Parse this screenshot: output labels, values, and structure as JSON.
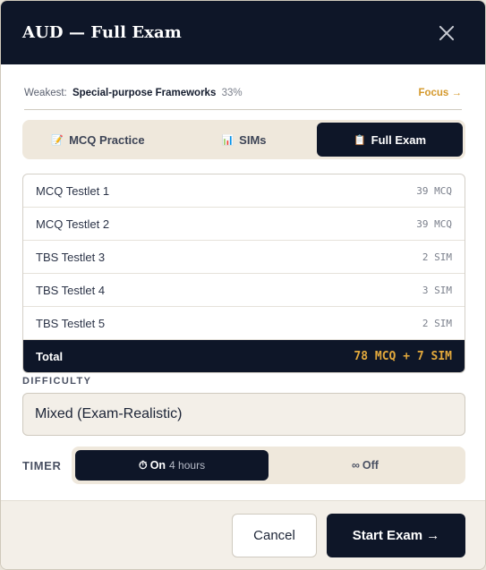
{
  "modal": {
    "title": "AUD — Full Exam",
    "close_icon": "close-icon"
  },
  "weakness": {
    "label": "Weakest:",
    "topic": "Special-purpose Frameworks",
    "percent": "33%",
    "focus_link": "Focus →"
  },
  "mode_tabs": [
    {
      "icon": "📝",
      "label": "MCQ Practice",
      "active": false
    },
    {
      "icon": "📊",
      "label": "SIMs",
      "active": false
    },
    {
      "icon": "📋",
      "label": "Full Exam",
      "active": true
    }
  ],
  "testlets": [
    {
      "name": "MCQ Testlet 1",
      "count": "39 MCQ"
    },
    {
      "name": "MCQ Testlet 2",
      "count": "39 MCQ"
    },
    {
      "name": "TBS Testlet 3",
      "count": "2 SIM"
    },
    {
      "name": "TBS Testlet 4",
      "count": "3 SIM"
    },
    {
      "name": "TBS Testlet 5",
      "count": "2 SIM"
    }
  ],
  "total": {
    "label": "Total",
    "value": "78 MCQ + 7 SIM"
  },
  "difficulty": {
    "label": "DIFFICULTY",
    "value": "Mixed (Exam-Realistic)"
  },
  "timer": {
    "label": "TIMER",
    "on_icon": "⏱",
    "on_label": "On",
    "on_sub": "4 hours",
    "off_icon": "∞",
    "off_label": "Off",
    "selected": "on"
  },
  "footer": {
    "cancel_label": "Cancel",
    "start_label": "Start Exam →"
  },
  "colors": {
    "navy": "#0e1628",
    "accent_gold": "#d4982b",
    "cream": "#efe8dc"
  }
}
